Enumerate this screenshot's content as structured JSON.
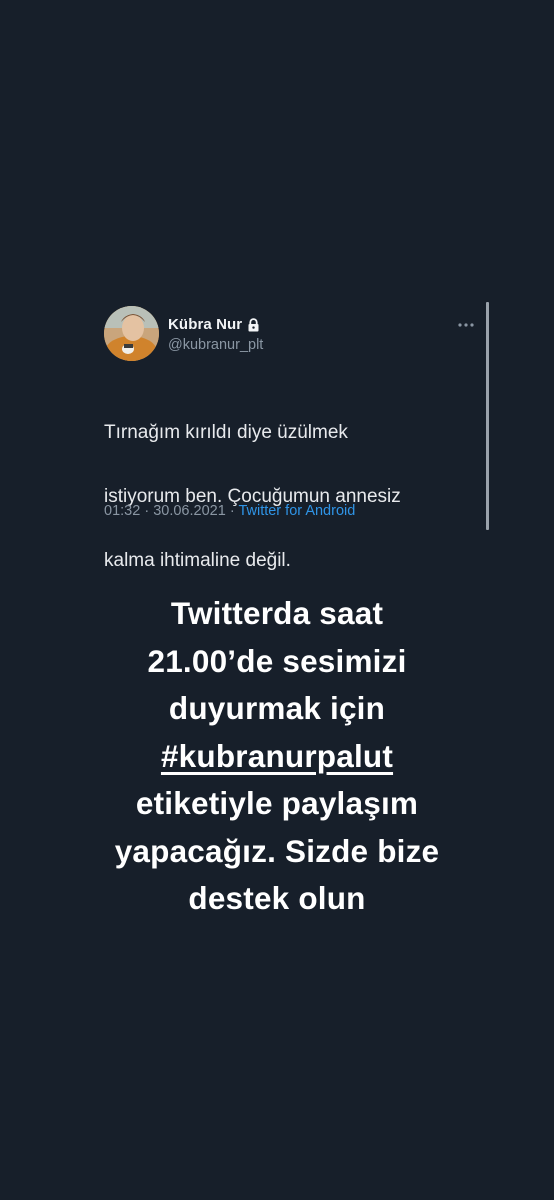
{
  "tweet": {
    "author_name": "Kübra Nur",
    "author_handle": "@kubranur_plt",
    "text_lines": [
      "Tırnağım kırıldı diye üzülmek",
      "istiyorum ben. Çocuğumun annesiz",
      "kalma ihtimaline değil."
    ],
    "time": "01:32",
    "separator": "·",
    "date": "30.06.2021",
    "source": "Twitter for Android",
    "icons": {
      "lock": "lock-icon",
      "more": "more-options-icon"
    }
  },
  "story": {
    "line1": "Twitterda saat",
    "line2": "21.00’de sesimizi",
    "line3": "duyurmak için",
    "hashtag": "#kubranurpalut",
    "line5": "etiketiyle paylaşım",
    "line6": "yapacağız. Sizde bize",
    "line7": "destek olun"
  },
  "colors": {
    "background": "#171f2a",
    "link": "#2f94e6",
    "muted": "#8a96a3",
    "text": "#e8eaed"
  }
}
